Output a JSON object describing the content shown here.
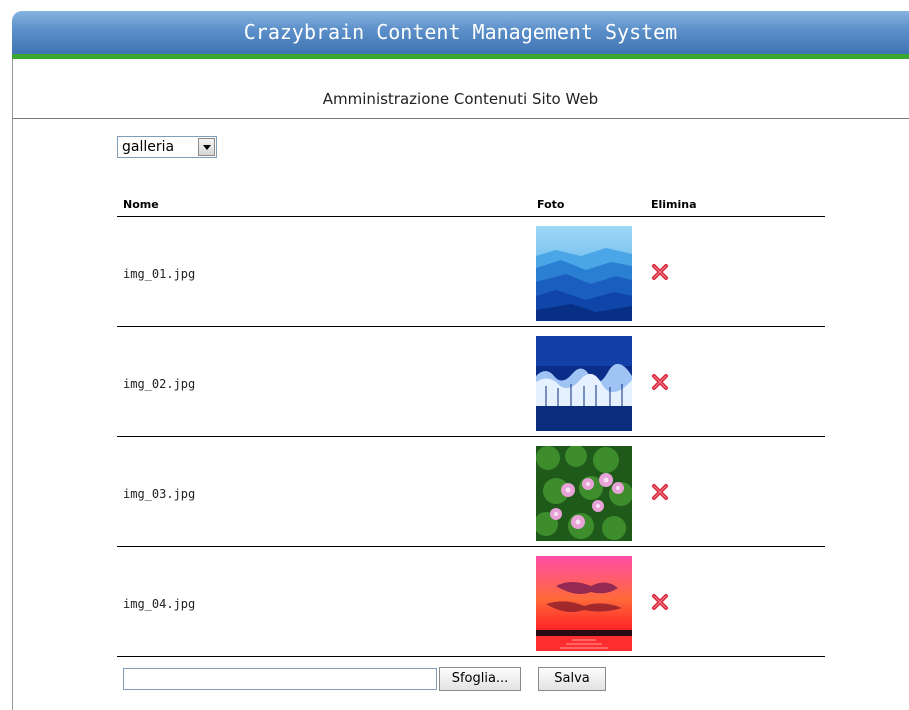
{
  "header": {
    "title": "Crazybrain Content Management System"
  },
  "subtitle": "Amministrazione Contenuti Sito Web",
  "section_select": {
    "value": "galleria"
  },
  "table": {
    "columns": [
      "Nome",
      "Foto",
      "Elimina"
    ],
    "rows": [
      {
        "name": "img_01.jpg",
        "photo": "blue-mountains-photo"
      },
      {
        "name": "img_02.jpg",
        "photo": "frosted-forest-photo"
      },
      {
        "name": "img_03.jpg",
        "photo": "pink-flowers-photo"
      },
      {
        "name": "img_04.jpg",
        "photo": "red-sunset-photo"
      }
    ]
  },
  "upload": {
    "file_value": "",
    "browse_label": "Sfoglia...",
    "save_label": "Salva"
  },
  "icons": {
    "delete": "delete-x-icon",
    "dropdown": "dropdown-arrow-icon"
  },
  "colors": {
    "header": "#5b8fc9",
    "accent_bar": "#3aa832",
    "delete": "#d7263d"
  }
}
